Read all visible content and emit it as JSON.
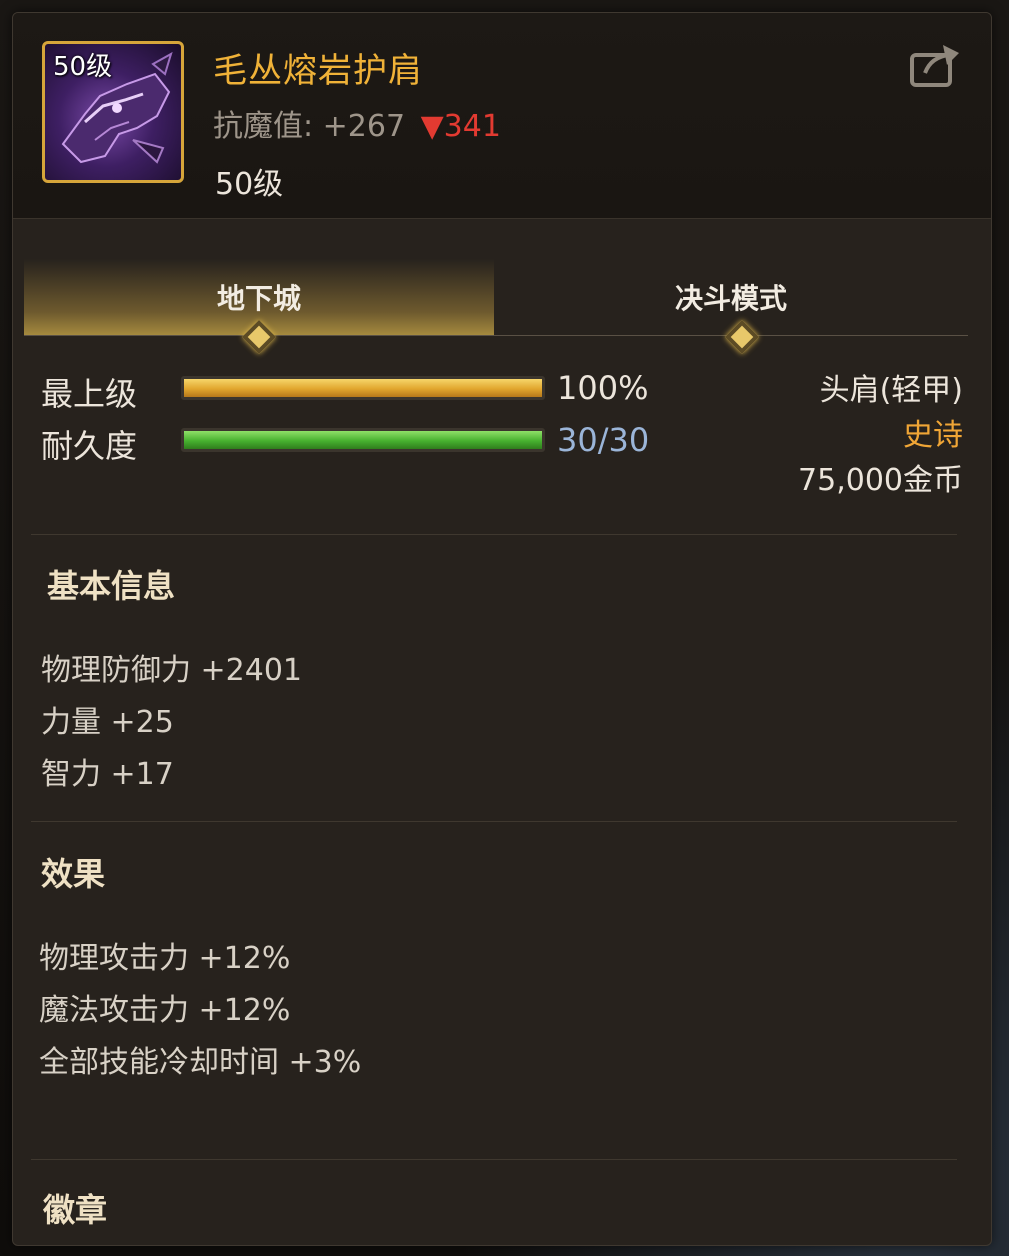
{
  "item": {
    "icon_level_badge": "50级",
    "name": "毛丛熔岩护肩",
    "resist_label": "抗魔值:",
    "resist_value": "+267",
    "resist_down": "▼341",
    "level_text": "50级",
    "icon_name": "wolf-shoulder-armor-icon"
  },
  "header": {
    "share_icon": "share-export-icon"
  },
  "tabs": [
    {
      "label": "地下城",
      "active": true
    },
    {
      "label": "决斗模式",
      "active": false
    }
  ],
  "bars": {
    "grade": {
      "label": "最上级",
      "value_text": "100%",
      "fraction": 1.0
    },
    "durability": {
      "label": "耐久度",
      "value_text": "30/30",
      "fraction": 1.0
    }
  },
  "info": {
    "slot": "头肩(轻甲)",
    "rarity": "史诗",
    "price": "75,000金币"
  },
  "sections": {
    "basic": {
      "title": "基本信息",
      "lines": [
        "物理防御力 +2401",
        "力量 +25",
        "智力 +17"
      ]
    },
    "effects": {
      "title": "效果",
      "lines": [
        "物理攻击力 +12%",
        "魔法攻击力 +12%",
        "全部技能冷却时间 +3%"
      ]
    },
    "emblem": {
      "title": "徽章"
    }
  },
  "colors": {
    "name_gold": "#f0b238",
    "rarity_orange": "#f0a636",
    "resist_down_red": "#e23a31",
    "durability_blue": "#9bb5d8"
  }
}
